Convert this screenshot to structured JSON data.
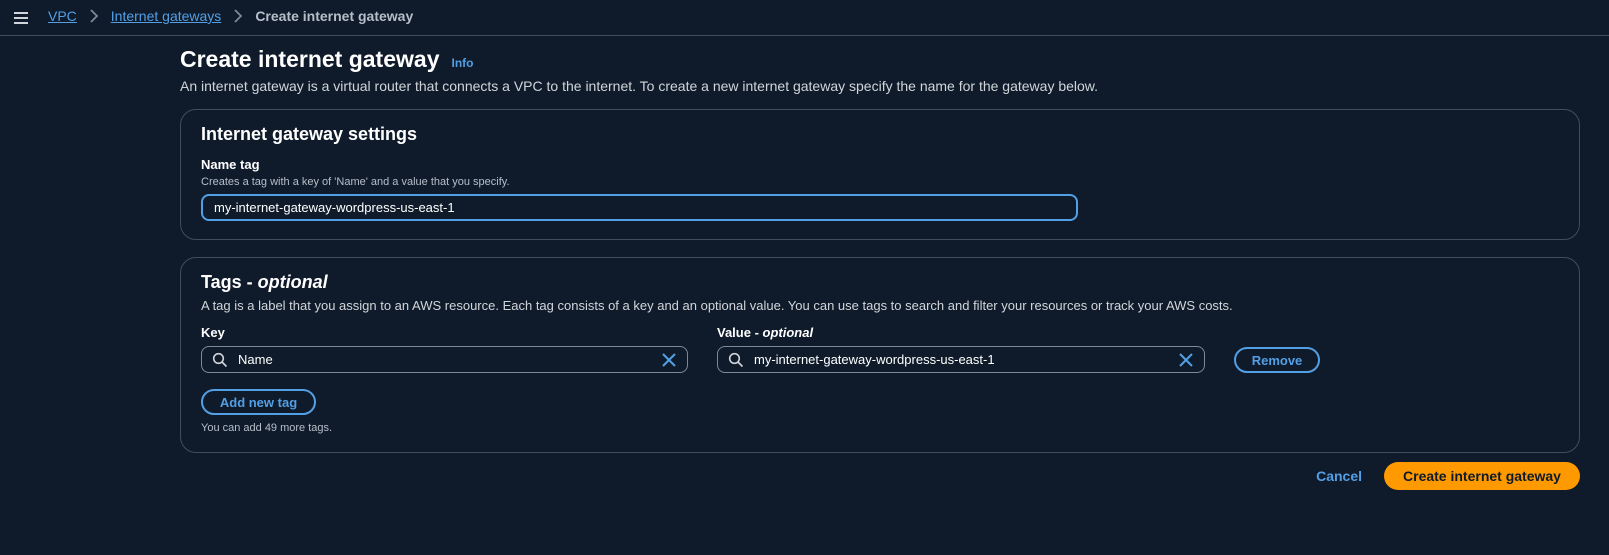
{
  "colors": {
    "background": "#0f1b2a",
    "link": "#539fe5",
    "primary_button": "#ff9900",
    "border": "#414d5c"
  },
  "breadcrumb": {
    "items": [
      {
        "label": "VPC"
      },
      {
        "label": "Internet gateways"
      },
      {
        "label": "Create internet gateway"
      }
    ]
  },
  "header": {
    "title": "Create internet gateway",
    "info_label": "Info",
    "description": "An internet gateway is a virtual router that connects a VPC to the internet. To create a new internet gateway specify the name for the gateway below."
  },
  "settings": {
    "title": "Internet gateway settings",
    "name_tag_label": "Name tag",
    "name_tag_description": "Creates a tag with a key of 'Name' and a value that you specify.",
    "name_tag_value": "my-internet-gateway-wordpress-us-east-1"
  },
  "tags": {
    "title": "Tags - ",
    "title_optional": "optional",
    "description": "A tag is a label that you assign to an AWS resource. Each tag consists of a key and an optional value. You can use tags to search and filter your resources or track your AWS costs.",
    "key_label": "Key",
    "value_label": "Value - ",
    "value_label_optional": "optional",
    "rows": [
      {
        "key": "Name",
        "value": "my-internet-gateway-wordpress-us-east-1"
      }
    ],
    "remove_label": "Remove",
    "add_label": "Add new tag",
    "limit_text": "You can add 49 more tags."
  },
  "footer": {
    "cancel_label": "Cancel",
    "submit_label": "Create internet gateway"
  },
  "icons": {
    "menu": "hamburger-icon",
    "breadcrumb_separator": "chevron-right-icon",
    "search": "search-icon",
    "clear": "close-icon"
  }
}
